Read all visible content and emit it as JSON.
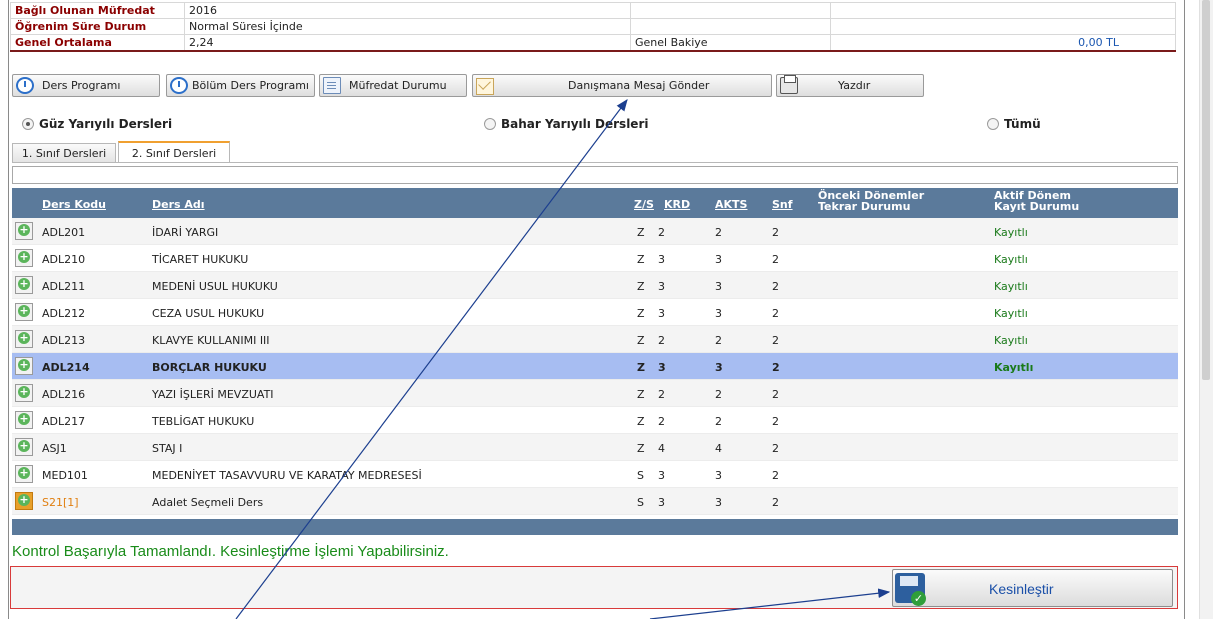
{
  "info": {
    "rows": [
      {
        "label": "Bağlı Olunan Müfredat",
        "value": "2016",
        "extra_label": "",
        "extra_value": ""
      },
      {
        "label": "Öğrenim Süre Durum",
        "value": "Normal Süresi İçinde",
        "extra_label": "",
        "extra_value": ""
      },
      {
        "label": "Genel Ortalama",
        "value": "2,24",
        "extra_label": "Genel Bakiye",
        "extra_value": "0,00 TL"
      }
    ]
  },
  "toolbar": {
    "ders_programi": "Ders Programı",
    "bolum_ders_programi": "Bölüm Ders Programı",
    "mufredat_durumu": "Müfredat Durumu",
    "danismana_mesaj": "Danışmana Mesaj Gönder",
    "yazdir": "Yazdır"
  },
  "semester": {
    "fall": "Güz Yarıyılı Dersleri",
    "spring": "Bahar Yarıyılı Dersleri",
    "all": "Tümü",
    "selected": "fall"
  },
  "tabs": {
    "year1": "1. Sınıf Dersleri",
    "year2": "2. Sınıf Dersleri",
    "active": "year2"
  },
  "grid": {
    "headers": {
      "code": "Ders Kodu",
      "name": "Ders Adı",
      "zs": "Z/S",
      "krd": "KRD",
      "akts": "AKTS",
      "snf": "Snf",
      "prev_line1": "Önceki Dönemler",
      "prev_line2": "Tekrar Durumu",
      "active_line1": "Aktif Dönem",
      "active_line2": "Kayıt Durumu"
    },
    "rows": [
      {
        "code": "ADL201",
        "name": "İDARİ YARGI",
        "zs": "Z",
        "krd": "2",
        "akts": "2",
        "snf": "2",
        "prev": "",
        "status": "Kayıtlı"
      },
      {
        "code": "ADL210",
        "name": "TİCARET HUKUKU",
        "zs": "Z",
        "krd": "3",
        "akts": "3",
        "snf": "2",
        "prev": "",
        "status": "Kayıtlı"
      },
      {
        "code": "ADL211",
        "name": "MEDENİ USUL HUKUKU",
        "zs": "Z",
        "krd": "3",
        "akts": "3",
        "snf": "2",
        "prev": "",
        "status": "Kayıtlı"
      },
      {
        "code": "ADL212",
        "name": "CEZA USUL HUKUKU",
        "zs": "Z",
        "krd": "3",
        "akts": "3",
        "snf": "2",
        "prev": "",
        "status": "Kayıtlı"
      },
      {
        "code": "ADL213",
        "name": "KLAVYE KULLANIMI III",
        "zs": "Z",
        "krd": "2",
        "akts": "2",
        "snf": "2",
        "prev": "",
        "status": "Kayıtlı"
      },
      {
        "code": "ADL214",
        "name": "BORÇLAR HUKUKU",
        "zs": "Z",
        "krd": "3",
        "akts": "3",
        "snf": "2",
        "prev": "",
        "status": "Kayıtlı"
      },
      {
        "code": "ADL216",
        "name": "YAZI İŞLERİ MEVZUATI",
        "zs": "Z",
        "krd": "2",
        "akts": "2",
        "snf": "2",
        "prev": "",
        "status": ""
      },
      {
        "code": "ADL217",
        "name": "TEBLİGAT HUKUKU",
        "zs": "Z",
        "krd": "2",
        "akts": "2",
        "snf": "2",
        "prev": "",
        "status": ""
      },
      {
        "code": "ASJ1",
        "name": "STAJ I",
        "zs": "Z",
        "krd": "4",
        "akts": "4",
        "snf": "2",
        "prev": "",
        "status": ""
      },
      {
        "code": "MED101",
        "name": "MEDENİYET TASAVVURU VE KARATAY MEDRESESİ",
        "zs": "S",
        "krd": "3",
        "akts": "3",
        "snf": "2",
        "prev": "",
        "status": ""
      },
      {
        "code": "S21[1]",
        "name": "Adalet Seçmeli Ders",
        "zs": "S",
        "krd": "3",
        "akts": "3",
        "snf": "2",
        "prev": "",
        "status": ""
      }
    ],
    "selected_row": "ADL214"
  },
  "message": "Kontrol Başarıyla Tamamlandı. Kesinleştirme İşlemi Yapabilirsiniz.",
  "confirm_button": "Kesinleştir",
  "colors": {
    "header_bg": "#5b7a9b",
    "selected_row": "#a7bdf2",
    "status_green": "#1a7a1a",
    "message_green": "#1a8c1a",
    "label_red": "#8b0000",
    "elective_orange": "#e07f10",
    "annotation_arrow": "#1c3f8f"
  },
  "icons": {
    "ders_programi": "clock-icon",
    "bolum_ders_programi": "clock-icon",
    "mufredat_durumu": "document-icon",
    "danismana_mesaj": "envelope-icon",
    "yazdir": "printer-icon",
    "row_add": "plus-circle-icon",
    "confirm": "save-check-icon"
  }
}
